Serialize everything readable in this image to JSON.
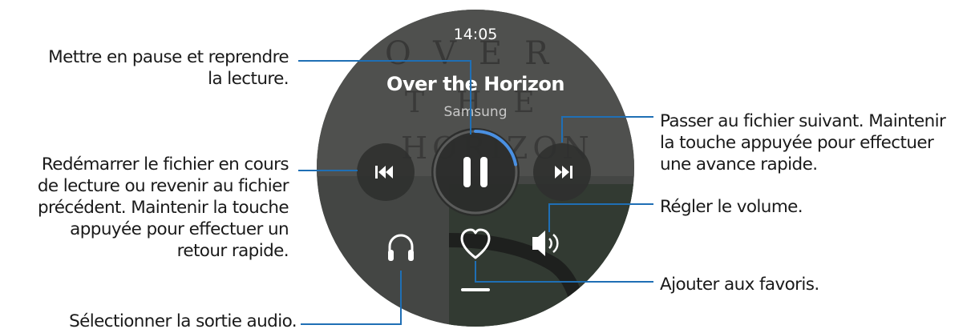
{
  "watch": {
    "time": "14:05",
    "song_title": "Over the Horizon",
    "artist": "Samsung",
    "playback_progress": 0.22,
    "album_art_text": "OVER THE HORIZON",
    "colors": {
      "accent": "#4a90e2",
      "callout_line": "#1f6fb5",
      "face_dark": "#3a3d3b",
      "button_fill": "#2f302f"
    },
    "icons": {
      "previous": "skip-previous-icon",
      "play_pause": "pause-icon",
      "next": "skip-next-icon",
      "audio_output": "headphones-icon",
      "favorite": "heart-icon",
      "volume": "volume-icon"
    }
  },
  "callouts": {
    "pause_resume": "Mettre en pause et reprendre\nla lecture.",
    "restart_previous": "Redémarrer le fichier en cours\nde lecture ou revenir au fichier\nprécédent. Maintenir la touche\nappuyée pour effectuer un\nretour rapide.",
    "audio_output": "Sélectionner la sortie audio.",
    "next_file": "Passer au fichier suivant. Maintenir\nla touche appuyée pour effectuer\nune avance rapide.",
    "volume": "Régler le volume.",
    "favorites": "Ajouter aux favoris."
  }
}
